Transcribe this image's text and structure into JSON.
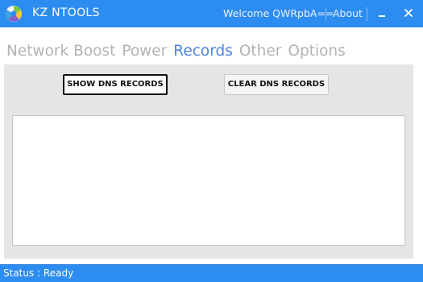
{
  "app": {
    "title": "KZ NTOOLS",
    "welcome": "Welcome QWRpbA==",
    "about_label": "About",
    "minimize_icon": "minimize-icon",
    "close_icon": "close-icon",
    "logo_icon": "app-logo-icon"
  },
  "tabs": [
    {
      "label": "Network Boost",
      "active": false
    },
    {
      "label": "Power",
      "active": false
    },
    {
      "label": "Records",
      "active": true
    },
    {
      "label": "Other",
      "active": false
    },
    {
      "label": "Options",
      "active": false
    }
  ],
  "records": {
    "show_button": "SHOW DNS RECORDS",
    "clear_button": "CLEAR DNS RECORDS",
    "output_text": ""
  },
  "status": {
    "text": "Status : Ready"
  },
  "colors": {
    "accent": "#2d8cf0",
    "tab_active": "#4c84e3",
    "tab_inactive": "#b3b3b3",
    "panel_bg": "#e5e5e5"
  }
}
